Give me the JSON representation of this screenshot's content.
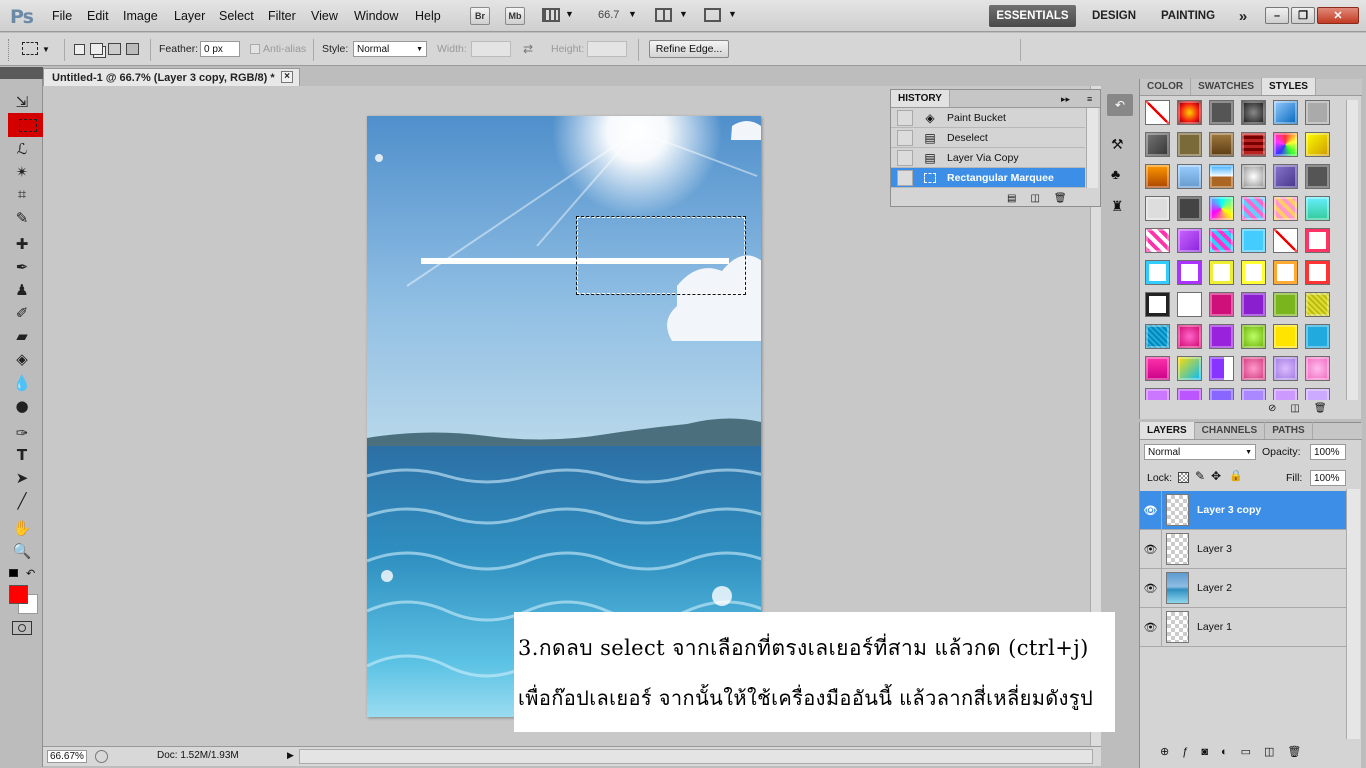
{
  "app": {
    "logo": "Ps",
    "menus": [
      "File",
      "Edit",
      "Image",
      "Layer",
      "Select",
      "Filter",
      "View",
      "Window",
      "Help"
    ],
    "bridge": "Br",
    "minibridge": "Mb",
    "zoom": "66.7",
    "workspaces": [
      "ESSENTIALS",
      "DESIGN",
      "PAINTING"
    ],
    "workspace_more": "»"
  },
  "options": {
    "feather_label": "Feather:",
    "feather_value": "0 px",
    "antialias_label": "Anti-alias",
    "style_label": "Style:",
    "style_value": "Normal",
    "width_label": "Width:",
    "height_label": "Height:",
    "refine": "Refine Edge..."
  },
  "document": {
    "tab_title": "Untitled-1 @ 66.7% (Layer 3 copy, RGB/8) *",
    "close": "×"
  },
  "status": {
    "zoom": "66.67%",
    "doc": "Doc: 1.52M/1.93M"
  },
  "history": {
    "title": "HISTORY",
    "items": [
      {
        "label": "Paint Bucket",
        "icon": "paint-bucket-icon"
      },
      {
        "label": "Deselect",
        "icon": "document-icon"
      },
      {
        "label": "Layer Via Copy",
        "icon": "document-icon"
      },
      {
        "label": "Rectangular Marquee",
        "icon": "marquee-icon"
      }
    ],
    "selected_index": 3
  },
  "styles_panel": {
    "tabs": [
      "COLOR",
      "SWATCHES",
      "STYLES"
    ],
    "active_tab": "STYLES"
  },
  "layers_panel": {
    "tabs": [
      "LAYERS",
      "CHANNELS",
      "PATHS"
    ],
    "active_tab": "LAYERS",
    "blend": "Normal",
    "opacity_label": "Opacity:",
    "opacity": "100%",
    "lock_label": "Lock:",
    "fill_label": "Fill:",
    "fill": "100%",
    "layers": [
      {
        "name": "Layer 3 copy",
        "selected": true
      },
      {
        "name": "Layer 3",
        "selected": false
      },
      {
        "name": "Layer 2",
        "selected": false
      },
      {
        "name": "Layer 1",
        "selected": false
      }
    ]
  },
  "colors": {
    "foreground": "#ff0000",
    "background": "#ffffff",
    "selection": "#3d8ee6",
    "tool_highlight": "#d40000"
  },
  "caption": {
    "line1": "3.กดลบ select จากเลือกที่ตรงเลเยอร์ที่สาม แล้วกด (ctrl+j)",
    "line2": "เพื่อก๊อปเลเยอร์ จากนั้นให้ใช้เครื่องมืออันนี้ แล้วลากสี่เหลี่ยมดังรูป"
  }
}
